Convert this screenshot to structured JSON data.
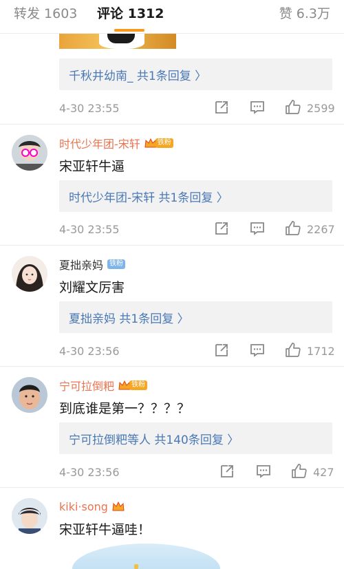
{
  "tabs": {
    "repost": "转发 1603",
    "comments": "评论 1312",
    "likes": "赞 6.3万"
  },
  "comments": [
    {
      "reply": "千秋井幼南_  共1条回复 〉",
      "time": "4-30 23:55",
      "likes": "2599"
    },
    {
      "user": "时代少年团-宋轩",
      "fan_tag": "铁粉",
      "text": "宋亚轩牛逼",
      "reply": "时代少年团-宋轩  共1条回复 〉",
      "time": "4-30 23:55",
      "likes": "2267"
    },
    {
      "user": "夏拙亲妈",
      "fan_tag": "铁粉",
      "text": "刘耀文厉害",
      "reply": "夏拙亲妈  共1条回复 〉",
      "time": "4-30 23:56",
      "likes": "1712"
    },
    {
      "user": "宁可拉倒粑",
      "fan_tag": "铁粉",
      "text": "到底谁是第一？？？？",
      "reply": "宁可拉倒粑等人  共140条回复 〉",
      "time": "4-30 23:56",
      "likes": "427"
    },
    {
      "user": "kiki·song",
      "text": "宋亚轩牛逼哇！"
    }
  ],
  "colors": {
    "accent": "#f79a1c",
    "username": "#eb7350",
    "link": "#4a78b5",
    "meta": "#999999"
  }
}
